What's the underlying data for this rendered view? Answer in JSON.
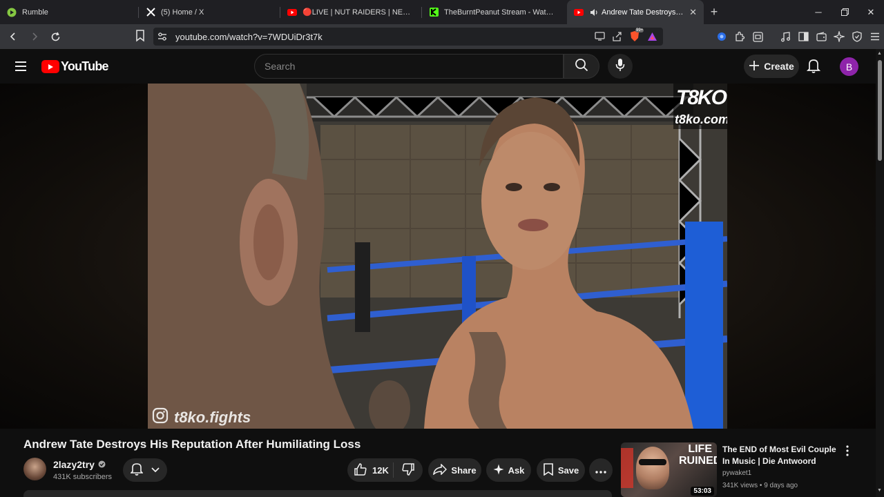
{
  "browser": {
    "tabs": [
      {
        "title": "Rumble",
        "icon": "rumble-icon",
        "active": false
      },
      {
        "title": "(5) Home / X",
        "icon": "x-icon",
        "active": false
      },
      {
        "title": "🔴LIVE | NUT RAIDERS | NEW YEAR |",
        "icon": "youtube-icon",
        "active": false
      },
      {
        "title": "TheBurntPeanut Stream - Watch Live",
        "icon": "kick-icon",
        "active": false
      },
      {
        "title": "Andrew Tate Destroys His Rep",
        "icon": "youtube-icon",
        "active": true
      }
    ],
    "new_tab": "+",
    "url": "youtube.com/watch?v=7WDUiDr3t7k",
    "brave_badge": "99+"
  },
  "youtube": {
    "logo_text": "YouTube",
    "search_placeholder": "Search",
    "create_label": "Create",
    "avatar_letter": "B",
    "colors": {
      "brand_red": "#ff0000",
      "avatar_purple": "#8e24aa"
    }
  },
  "video": {
    "watermark_top": "T8KO",
    "watermark_top_url": "t8ko.com",
    "watermark_bottom": "t8ko.fights",
    "title": "Andrew Tate Destroys His Reputation After Humiliating Loss",
    "channel_name": "2lazy2try",
    "channel_verified": true,
    "subscribers": "431K subscribers",
    "likes": "12K",
    "share_label": "Share",
    "ask_label": "Ask",
    "save_label": "Save"
  },
  "recommendation": {
    "thumbnail_text": "LIFE RUINED",
    "duration": "53:03",
    "title": "The END of Most Evil Couple In Music | Die Antwoord",
    "channel": "pywaket1",
    "meta": "341K views • 9 days ago"
  }
}
